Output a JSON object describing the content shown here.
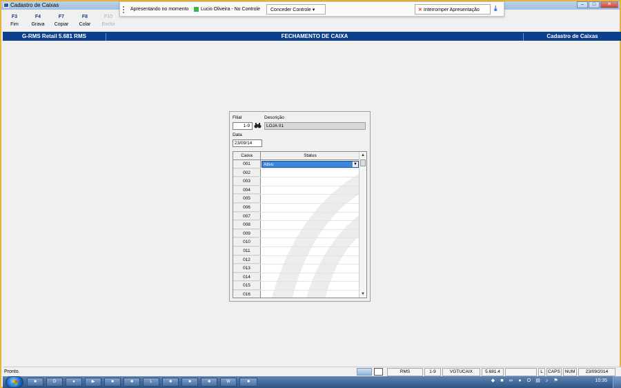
{
  "window": {
    "title": "Cadastro de Caixas"
  },
  "presentation": {
    "label": "Apresentando no momento",
    "presenter": "Lucio Oliveira - No Controle",
    "give_control": "Conceder Controle",
    "stop": "Interromper Apresentação"
  },
  "toolbar": [
    {
      "key": "F3",
      "label": "Fim"
    },
    {
      "key": "F4",
      "label": "Grava"
    },
    {
      "key": "F7",
      "label": "Copiar"
    },
    {
      "key": "F8",
      "label": "Colar"
    },
    {
      "key": "F10",
      "label": "Exclui"
    }
  ],
  "header": {
    "left": "G-RMS Retail 5.681 RMS",
    "center": "FECHAMENTO DE CAIXA",
    "right": "Cadastro de Caixas"
  },
  "form": {
    "filial_label": "Filial",
    "filial_value": "1-9",
    "descricao_label": "Descrição",
    "descricao_value": "LOJA 01",
    "data_label": "Data",
    "data_value": "23/09/14"
  },
  "grid": {
    "col_caixa": "Caixa",
    "col_status": "Status",
    "selected_status": "Ativo",
    "rows": [
      "001",
      "002",
      "003",
      "004",
      "005",
      "006",
      "007",
      "008",
      "009",
      "010",
      "011",
      "012",
      "013",
      "014",
      "015",
      "016"
    ]
  },
  "statusbar": {
    "message": "Pronto.",
    "rms": "RMS",
    "filial": "1-9",
    "program": "VGTUCAIX",
    "version": "5.681.4",
    "l": "L",
    "caps": "CAPS",
    "num": "NUM",
    "date": "23/09/2014"
  },
  "taskbar": {
    "clock": "10:35"
  },
  "colors": {
    "header_blue": "#0d3f8e",
    "frame_gold": "#e6b43c",
    "selection_blue": "#3a86e0"
  }
}
